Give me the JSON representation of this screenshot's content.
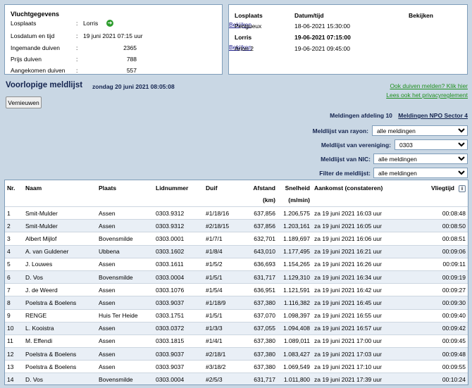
{
  "flight": {
    "title": "Vluchtgegevens",
    "rows": [
      {
        "label": "Losplaats",
        "value": "Lorris"
      },
      {
        "label": "Losdatum en tijd",
        "value": "19 juni 2021 07:15 uur"
      },
      {
        "label": "Ingemande duiven",
        "value": "2365"
      },
      {
        "label": "Prijs duiven",
        "value": "788"
      },
      {
        "label": "Aangekomen duiven",
        "value": "557"
      }
    ],
    "separator": ":"
  },
  "releases": {
    "headers": {
      "place": "Losplaats",
      "datetime": "Datum/tijd",
      "view": "Bekijken"
    },
    "rows": [
      {
        "place": "Perigueux",
        "datetime": "18-06-2021 15:30:00",
        "view": "Bekijken"
      },
      {
        "place": "Lorris",
        "datetime": "19-06-2021 07:15:00",
        "view": ""
      },
      {
        "place": "Arlon 2",
        "datetime": "19-06-2021 09:45:00",
        "view": "Bekijken"
      }
    ]
  },
  "header": {
    "title": "Voorlopige meldlijst",
    "date": "zondag 20 juni 2021 08:05:08",
    "refresh_label": "Vernieuwen",
    "report_link": "Ook duiven melden? Klik hier",
    "privacy_link": "Lees ook het privacyreglement"
  },
  "meldingen": {
    "afdeling": "Meldingen afdeling 10",
    "sector": "Meldingen NPO Sector 4"
  },
  "filters": {
    "rayon": {
      "label": "Meldlijst van rayon:",
      "value": "alle meldingen"
    },
    "vereniging": {
      "label": "Meldlijst van vereniging:",
      "value": "0303"
    },
    "nic": {
      "label": "Meldlijst van NIC:",
      "value": "alle meldingen"
    },
    "filter": {
      "label": "Filter de meldlijst:",
      "value": "alle meldingen"
    }
  },
  "table": {
    "headers": {
      "nr": "Nr.",
      "naam": "Naam",
      "plaats": "Plaats",
      "lidnummer": "Lidnummer",
      "duif": "Duif",
      "afstand": "Afstand",
      "afstand_unit": "(km)",
      "snelheid": "Snelheid",
      "snelheid_unit": "(m/min)",
      "aankomst": "Aankomst (constateren)",
      "vliegtijd": "Vliegtijd"
    },
    "rows": [
      {
        "nr": "1",
        "naam": "Smit-Mulder",
        "plaats": "Assen",
        "lid": "0303.9312",
        "duif": "#1/18/16",
        "afstand": "637,856",
        "snelheid": "1.206,575",
        "aankomst": "za 19 juni 2021 16:03 uur",
        "vliegtijd": "00:08:48"
      },
      {
        "nr": "2",
        "naam": "Smit-Mulder",
        "plaats": "Assen",
        "lid": "0303.9312",
        "duif": "#2/18/15",
        "afstand": "637,856",
        "snelheid": "1.203,161",
        "aankomst": "za 19 juni 2021 16:05 uur",
        "vliegtijd": "00:08:50"
      },
      {
        "nr": "3",
        "naam": "Albert Mijlof",
        "plaats": "Bovensmilde",
        "lid": "0303.0001",
        "duif": "#1/7/1",
        "afstand": "632,701",
        "snelheid": "1.189,697",
        "aankomst": "za 19 juni 2021 16:06 uur",
        "vliegtijd": "00:08:51"
      },
      {
        "nr": "4",
        "naam": "A. van Guldener",
        "plaats": "Ubbena",
        "lid": "0303.1602",
        "duif": "#1/8/4",
        "afstand": "643,010",
        "snelheid": "1.177,495",
        "aankomst": "za 19 juni 2021 16:21 uur",
        "vliegtijd": "00:09:06"
      },
      {
        "nr": "5",
        "naam": "J. Louwes",
        "plaats": "Assen",
        "lid": "0303.1611",
        "duif": "#1/5/2",
        "afstand": "636,693",
        "snelheid": "1.154,265",
        "aankomst": "za 19 juni 2021 16:26 uur",
        "vliegtijd": "00:09:11"
      },
      {
        "nr": "6",
        "naam": "D. Vos",
        "plaats": "Bovensmilde",
        "lid": "0303.0004",
        "duif": "#1/5/1",
        "afstand": "631,717",
        "snelheid": "1.129,310",
        "aankomst": "za 19 juni 2021 16:34 uur",
        "vliegtijd": "00:09:19"
      },
      {
        "nr": "7",
        "naam": "J. de Weerd",
        "plaats": "Assen",
        "lid": "0303.1076",
        "duif": "#1/5/4",
        "afstand": "636,951",
        "snelheid": "1.121,591",
        "aankomst": "za 19 juni 2021 16:42 uur",
        "vliegtijd": "00:09:27"
      },
      {
        "nr": "8",
        "naam": "Poelstra & Boelens",
        "plaats": "Assen",
        "lid": "0303.9037",
        "duif": "#1/18/9",
        "afstand": "637,380",
        "snelheid": "1.116,382",
        "aankomst": "za 19 juni 2021 16:45 uur",
        "vliegtijd": "00:09:30"
      },
      {
        "nr": "9",
        "naam": "RENGE",
        "plaats": "Huis Ter Heide",
        "lid": "0303.1751",
        "duif": "#1/5/1",
        "afstand": "637,070",
        "snelheid": "1.098,397",
        "aankomst": "za 19 juni 2021 16:55 uur",
        "vliegtijd": "00:09:40"
      },
      {
        "nr": "10",
        "naam": "L. Kooistra",
        "plaats": "Assen",
        "lid": "0303.0372",
        "duif": "#1/3/3",
        "afstand": "637,055",
        "snelheid": "1.094,408",
        "aankomst": "za 19 juni 2021 16:57 uur",
        "vliegtijd": "00:09:42"
      },
      {
        "nr": "11",
        "naam": "M. Effendi",
        "plaats": "Assen",
        "lid": "0303.1815",
        "duif": "#1/4/1",
        "afstand": "637,380",
        "snelheid": "1.089,011",
        "aankomst": "za 19 juni 2021 17:00 uur",
        "vliegtijd": "00:09:45"
      },
      {
        "nr": "12",
        "naam": "Poelstra & Boelens",
        "plaats": "Assen",
        "lid": "0303.9037",
        "duif": "#2/18/1",
        "afstand": "637,380",
        "snelheid": "1.083,427",
        "aankomst": "za 19 juni 2021 17:03 uur",
        "vliegtijd": "00:09:48"
      },
      {
        "nr": "13",
        "naam": "Poelstra & Boelens",
        "plaats": "Assen",
        "lid": "0303.9037",
        "duif": "#3/18/2",
        "afstand": "637,380",
        "snelheid": "1.069,549",
        "aankomst": "za 19 juni 2021 17:10 uur",
        "vliegtijd": "00:09:55"
      },
      {
        "nr": "14",
        "naam": "D. Vos",
        "plaats": "Bovensmilde",
        "lid": "0303.0004",
        "duif": "#2/5/3",
        "afstand": "631,717",
        "snelheid": "1.011,800",
        "aankomst": "za 19 juni 2021 17:39 uur",
        "vliegtijd": "00:10:24"
      }
    ]
  },
  "colors": {
    "background": "#c9d7e4",
    "title": "#14244f",
    "green_link": "#1f8f1f",
    "row_alt": "#e9eff6"
  },
  "icons": {
    "losplaats_arrow": "arrow-right-icon",
    "vliegtijd_info": "info-icon"
  }
}
